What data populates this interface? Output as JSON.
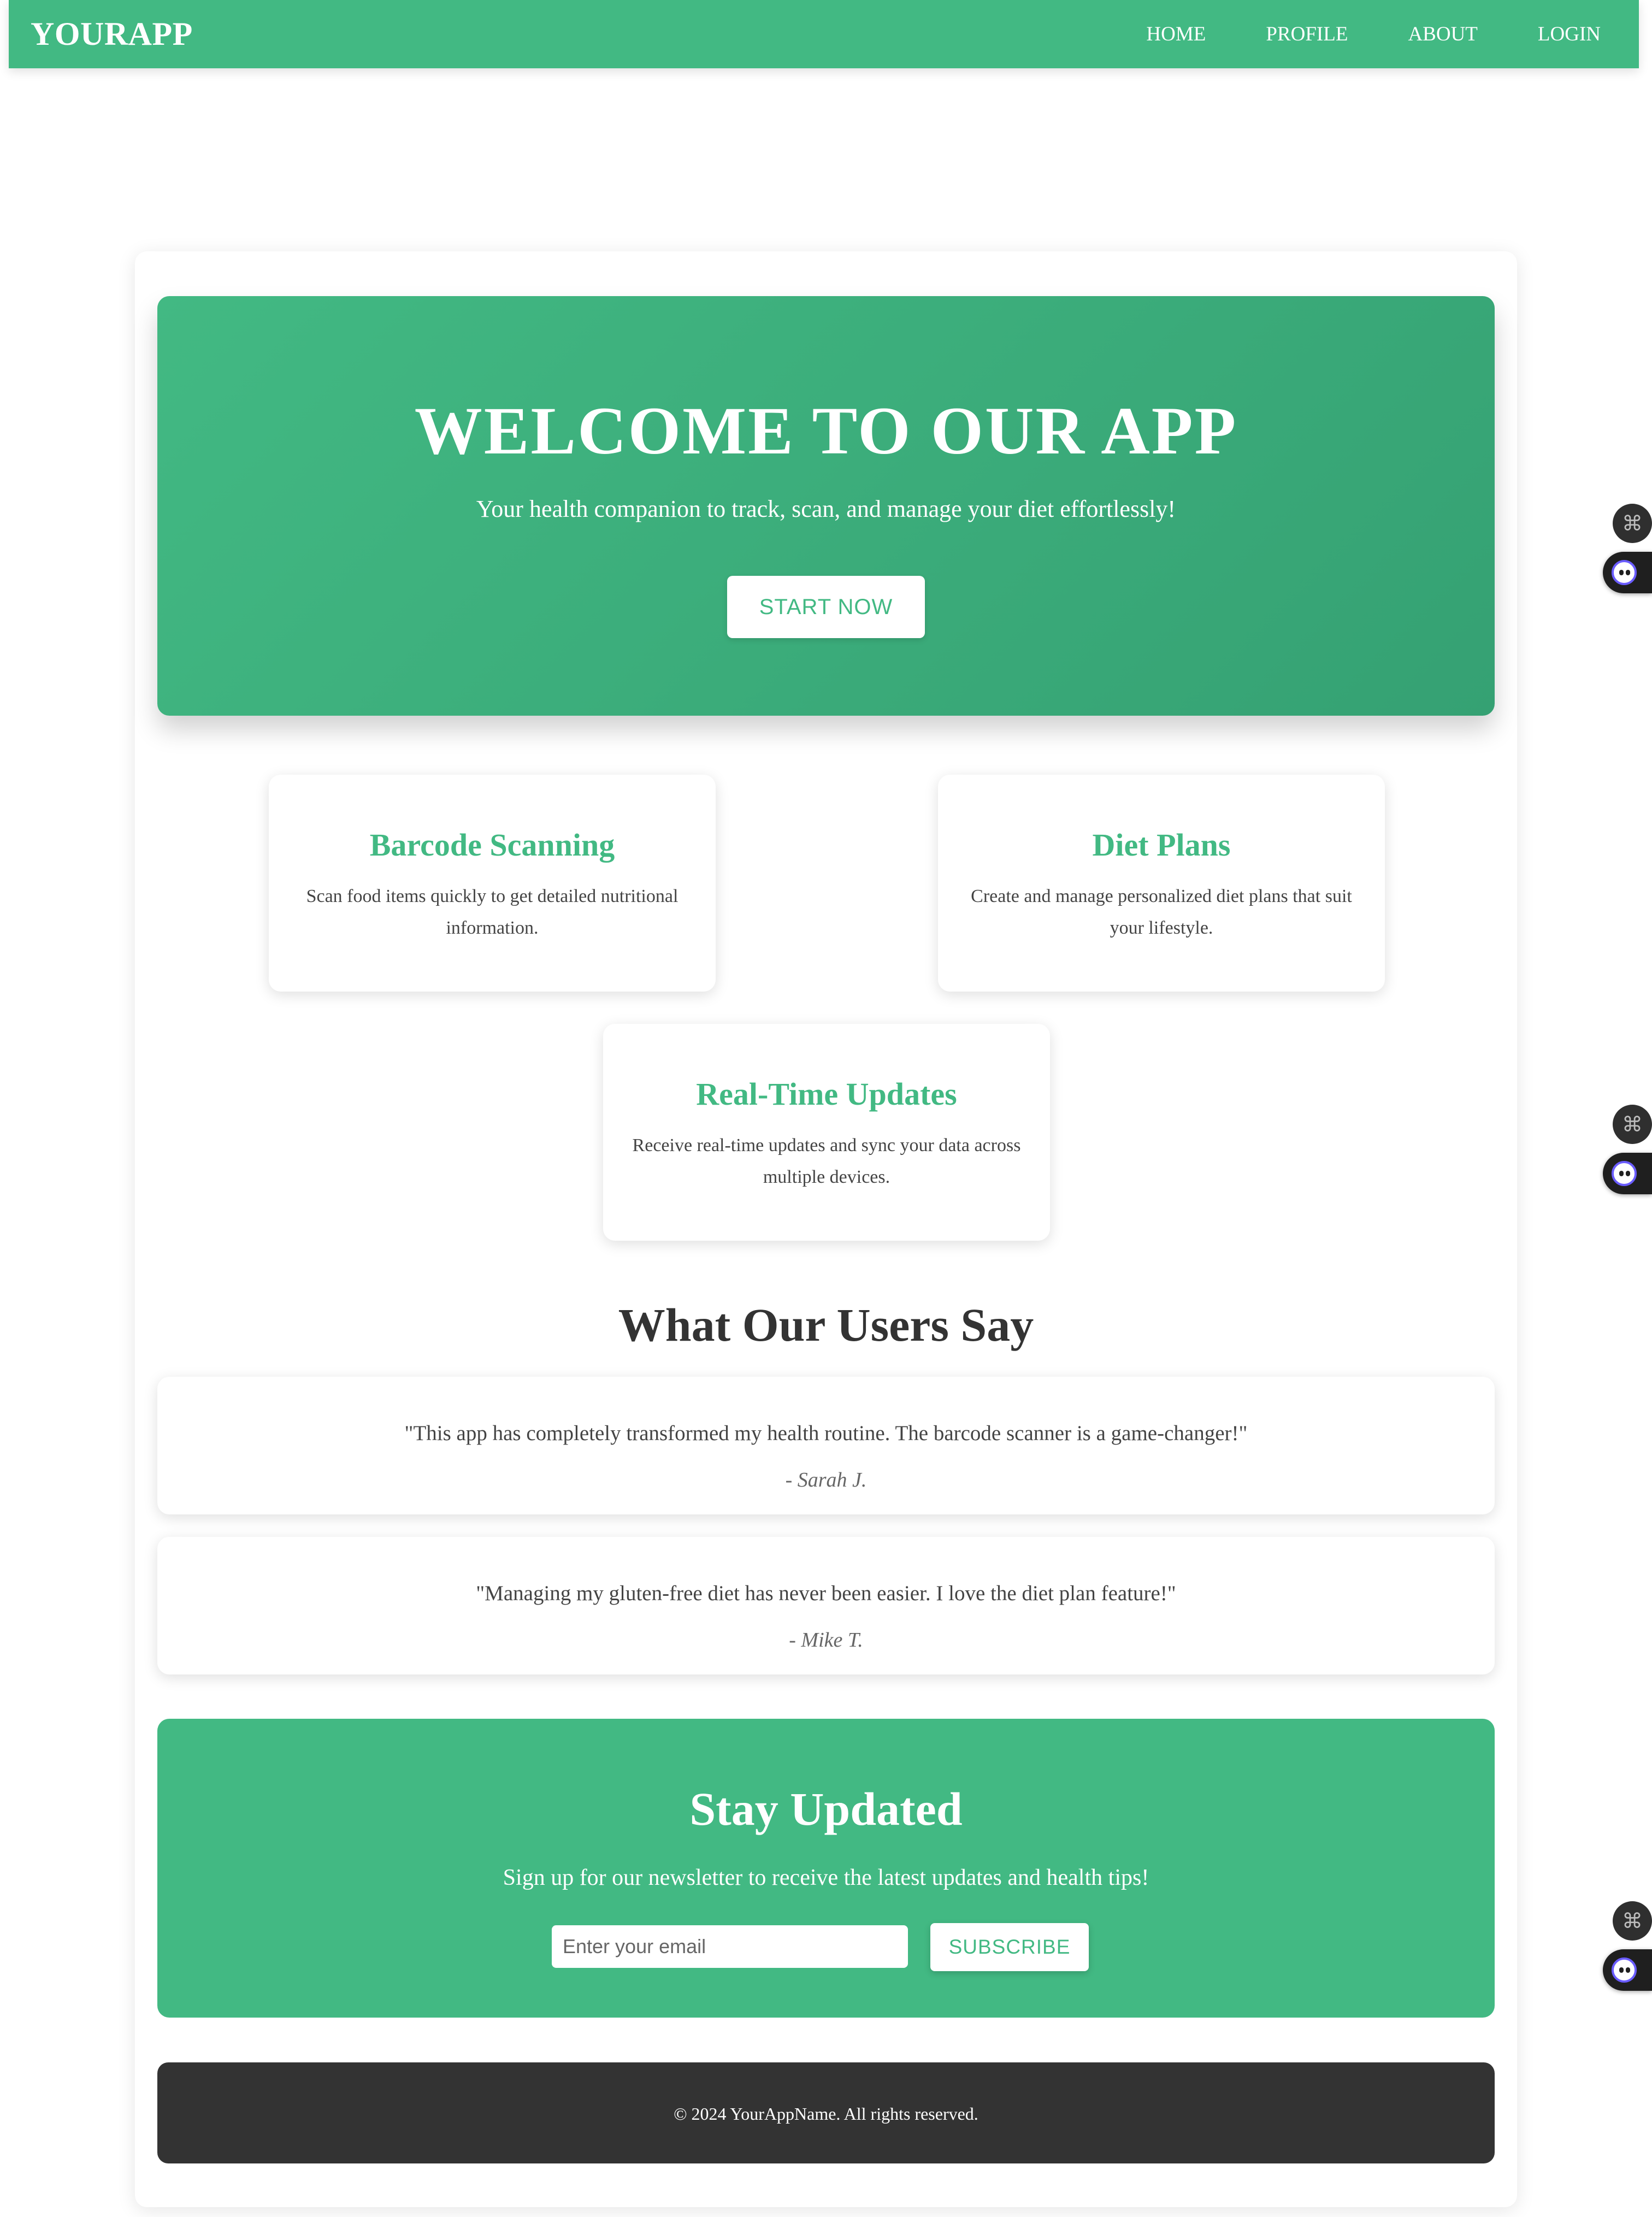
{
  "nav": {
    "brand": "YOURAPP",
    "links": [
      "HOME",
      "PROFILE",
      "ABOUT",
      "LOGIN"
    ]
  },
  "hero": {
    "title": "WELCOME TO OUR APP",
    "subtitle": "Your health companion to track, scan, and manage your diet effortlessly!",
    "button_label": "START NOW"
  },
  "features": [
    {
      "title": "Barcode Scanning",
      "description": "Scan food items quickly to get detailed nutritional information."
    },
    {
      "title": "Diet Plans",
      "description": "Create and manage personalized diet plans that suit your lifestyle."
    },
    {
      "title": "Real-Time Updates",
      "description": "Receive real-time updates and sync your data across multiple devices."
    }
  ],
  "testimonials": {
    "title": "What Our Users Say",
    "items": [
      {
        "quote": "\"This app has completely transformed my health routine. The barcode scanner is a game-changer!\"",
        "author": "- Sarah J."
      },
      {
        "quote": "\"Managing my gluten-free diet has never been easier. I love the diet plan feature!\"",
        "author": "- Mike T."
      }
    ]
  },
  "newsletter": {
    "title": "Stay Updated",
    "subtitle": "Sign up for our newsletter to receive the latest updates and health tips!",
    "email_placeholder": "Enter your email",
    "email_value": "",
    "button_label": "SUBSCRIBE"
  },
  "footer": {
    "text": "© 2024 YourAppName. All rights reserved."
  },
  "widgets": {
    "command_glyph": "⌘",
    "icons": [
      "command-icon",
      "assistant-bot-icon"
    ]
  },
  "colors": {
    "brand_green": "#42b983",
    "footer_dark": "#333333",
    "background": "#ffffff"
  }
}
